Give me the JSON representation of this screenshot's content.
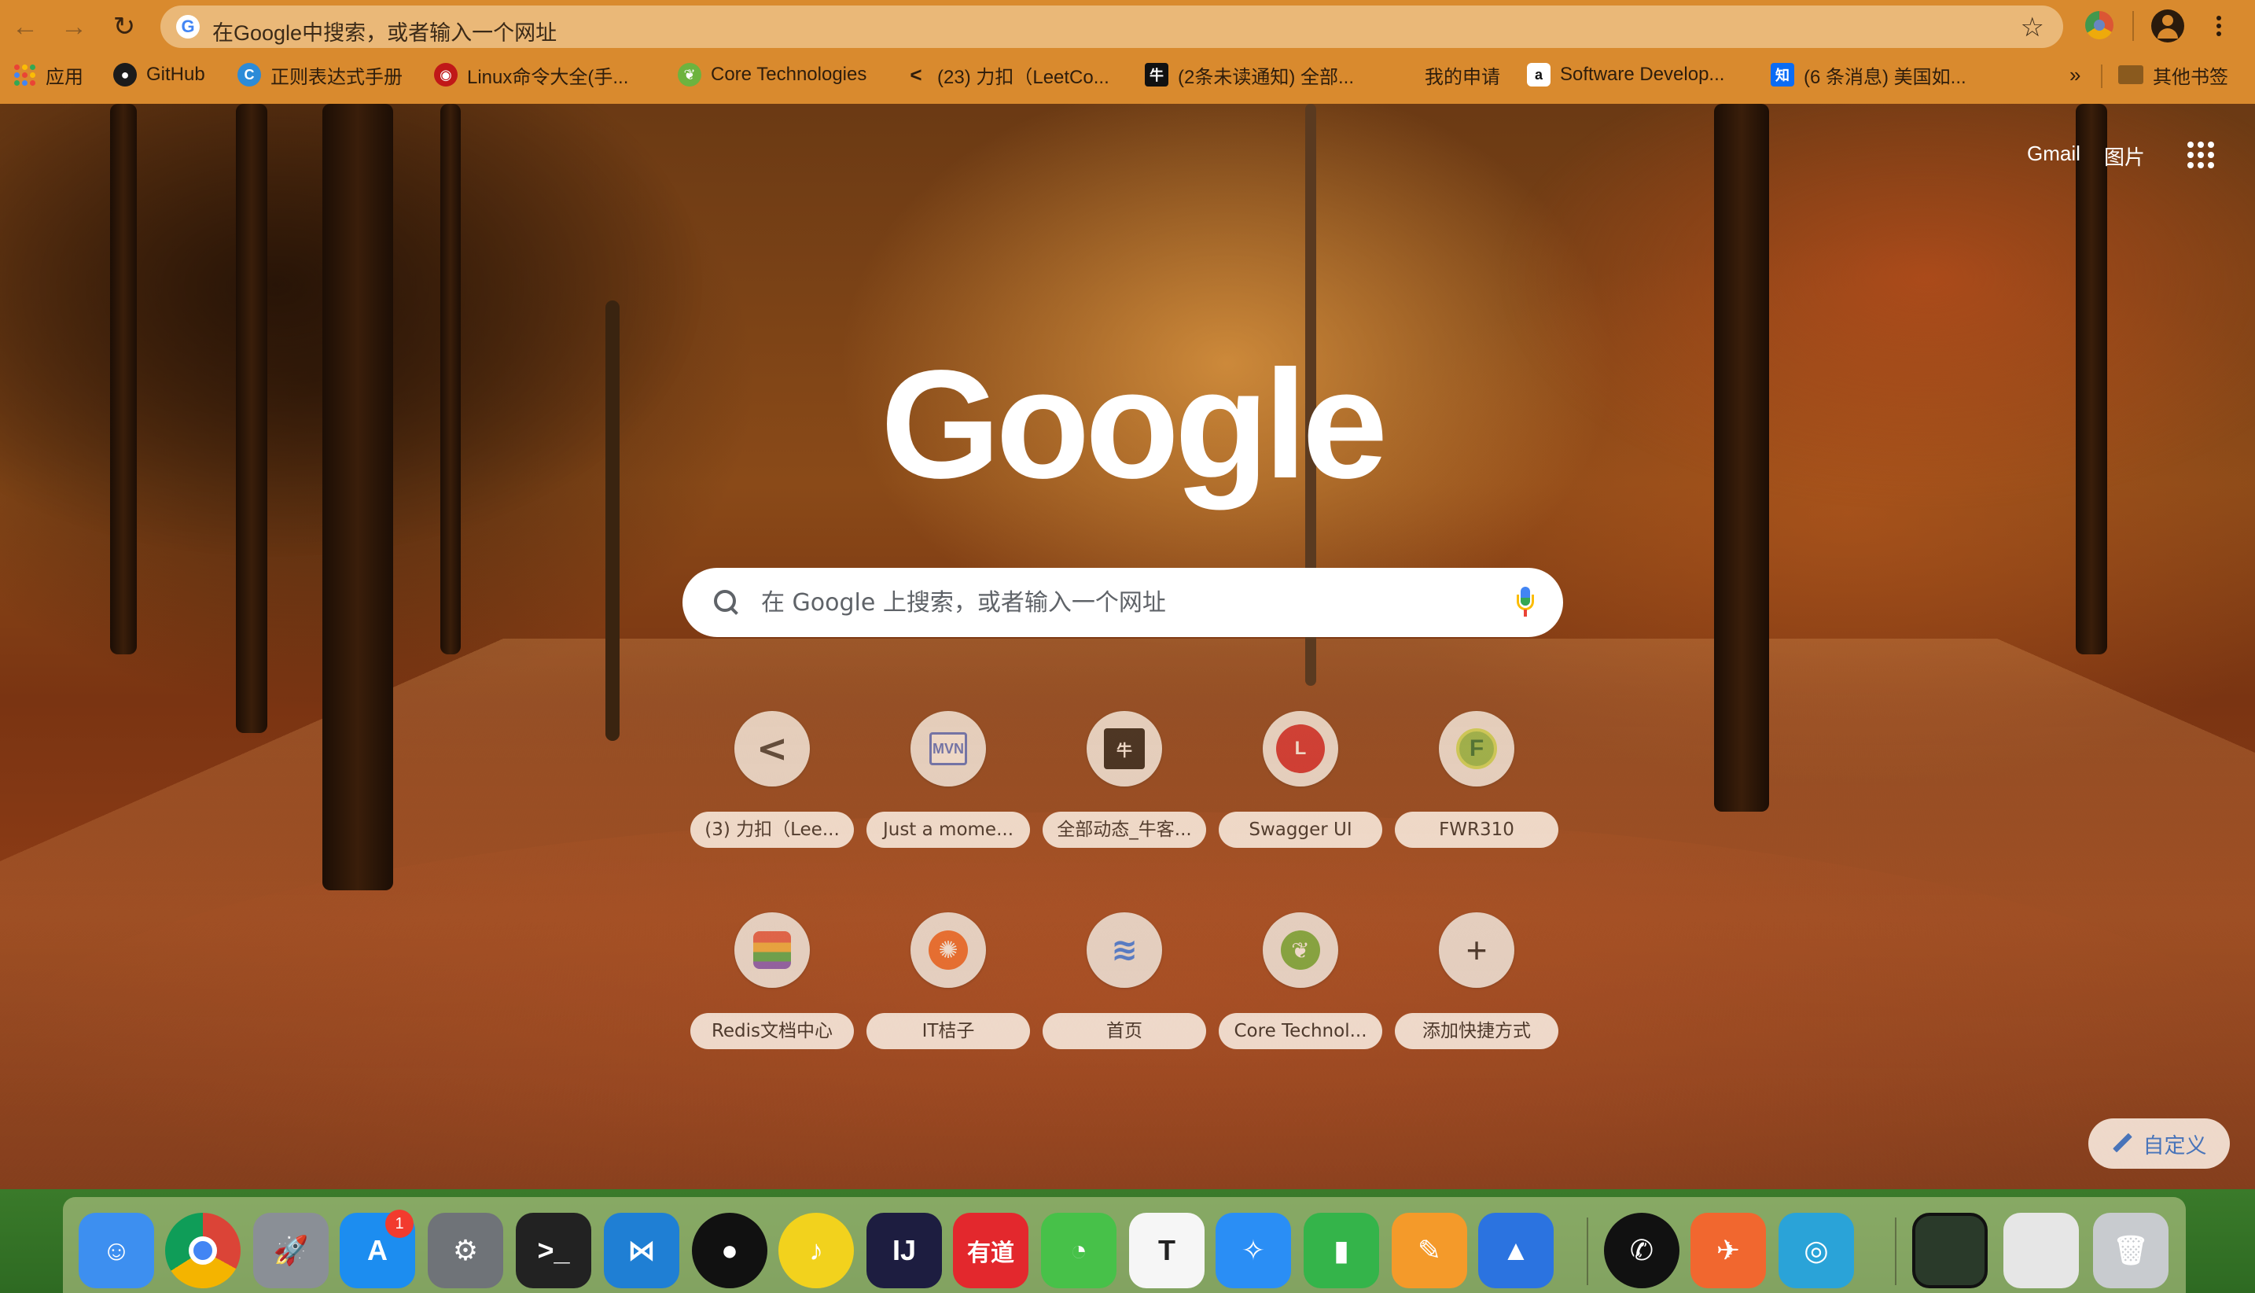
{
  "omnibox": {
    "text": "在Google中搜索，或者输入一个网址"
  },
  "bookmarks": {
    "items": [
      {
        "label": "应用",
        "icon": "apps-grid-icon"
      },
      {
        "label": "GitHub",
        "icon": "github-icon"
      },
      {
        "label": "正则表达式手册",
        "icon": "regex-icon"
      },
      {
        "label": "Linux命令大全(手...",
        "icon": "linux-icon"
      },
      {
        "label": "Core Technologies",
        "icon": "spring-icon"
      },
      {
        "label": "(23) 力扣（LeetCo...",
        "icon": "leetcode-icon"
      },
      {
        "label": "(2条未读通知) 全部...",
        "icon": "nowcoder-icon"
      },
      {
        "label": "我的申请",
        "icon": ""
      },
      {
        "label": "Software Develop...",
        "icon": "amazon-icon"
      },
      {
        "label": "(6 条消息) 美国如...",
        "icon": "zhihu-icon"
      }
    ],
    "more": "»",
    "other": "其他书签"
  },
  "header_links": {
    "gmail": "Gmail",
    "images": "图片"
  },
  "logo_text": "Google",
  "search": {
    "placeholder": "在 Google 上搜索，或者输入一个网址"
  },
  "shortcuts": [
    {
      "label": "(3) 力扣（Lee...",
      "icon": "leetcode-icon",
      "glyph": "<"
    },
    {
      "label": "Just a mome...",
      "icon": "mvn-icon",
      "glyph": "MVN"
    },
    {
      "label": "全部动态_牛客...",
      "icon": "nowcoder-icon",
      "glyph": "牛"
    },
    {
      "label": "Swagger UI",
      "icon": "swagger-icon",
      "glyph": "L"
    },
    {
      "label": "FWR310",
      "icon": "fwr-icon",
      "glyph": "F"
    },
    {
      "label": "Redis文档中心",
      "icon": "redis-icon",
      "glyph": ""
    },
    {
      "label": "IT桔子",
      "icon": "orange-icon",
      "glyph": "✺"
    },
    {
      "label": "首页",
      "icon": "home-logo-icon",
      "glyph": "≋"
    },
    {
      "label": "Core Technol...",
      "icon": "spring-icon",
      "glyph": "❦"
    },
    {
      "label": "添加快捷方式",
      "icon": "add-icon",
      "glyph": "+"
    }
  ],
  "customize": {
    "label": "自定义"
  },
  "dock": {
    "badge": "1",
    "items": [
      {
        "name": "finder-icon",
        "glyph": "☺",
        "color": "#3d8ff0"
      },
      {
        "name": "chrome-icon",
        "glyph": "",
        "color": "#ffffff"
      },
      {
        "name": "launchpad-icon",
        "glyph": "🚀",
        "color": "#8a8f96"
      },
      {
        "name": "app-store-icon",
        "glyph": "A",
        "color": "#1c8df0"
      },
      {
        "name": "system-preferences-icon",
        "glyph": "⚙",
        "color": "#6f7378"
      },
      {
        "name": "terminal-icon",
        "glyph": ">_",
        "color": "#222222"
      },
      {
        "name": "vscode-icon",
        "glyph": "⋈",
        "color": "#1f7fd4"
      },
      {
        "name": "qq-icon",
        "glyph": "●",
        "color": "#111111"
      },
      {
        "name": "music-icon",
        "glyph": "♪",
        "color": "#f2d21d"
      },
      {
        "name": "intellij-icon",
        "glyph": "IJ",
        "color": "#1d1d40"
      },
      {
        "name": "youdao-icon",
        "glyph": "有道",
        "color": "#e3282d"
      },
      {
        "name": "wechat-icon",
        "glyph": "◔",
        "color": "#47c149"
      },
      {
        "name": "typora-icon",
        "glyph": "T",
        "color": "#f6f6f6"
      },
      {
        "name": "safari-icon",
        "glyph": "✧",
        "color": "#2a8ef5"
      },
      {
        "name": "numbers-icon",
        "glyph": "▮",
        "color": "#34b44a"
      },
      {
        "name": "pages-icon",
        "glyph": "✎",
        "color": "#f49a2a"
      },
      {
        "name": "keynote-icon",
        "glyph": "▲",
        "color": "#2b73e0"
      },
      {
        "name": "kindle-icon",
        "glyph": "✆",
        "color": "#111111"
      },
      {
        "name": "postman-icon",
        "glyph": "✈",
        "color": "#f1672f"
      },
      {
        "name": "navicat-icon",
        "glyph": "◎",
        "color": "#2aa3d8"
      },
      {
        "name": "terminal-window-icon",
        "glyph": "",
        "color": "#2a3a2a"
      },
      {
        "name": "preview-window-icon",
        "glyph": "",
        "color": "#e6e6e6"
      },
      {
        "name": "trash-icon",
        "glyph": "🗑",
        "color": "#c8cbcf"
      }
    ]
  }
}
